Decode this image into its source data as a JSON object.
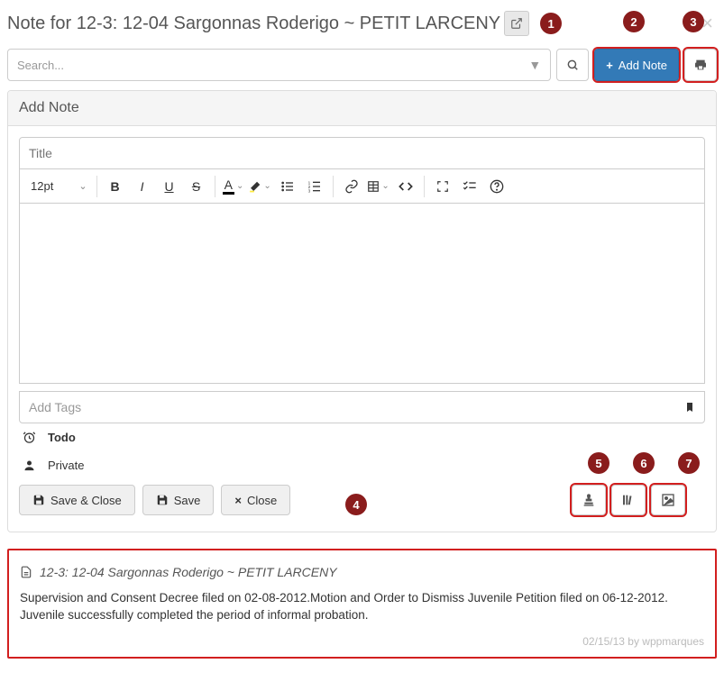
{
  "header": {
    "title": "Note for 12-3: 12-04 Sargonnas Roderigo ~ PETIT LARCENY"
  },
  "search": {
    "placeholder": "Search..."
  },
  "addNote": {
    "label": "Add Note"
  },
  "panel": {
    "title": "Add Note"
  },
  "editor": {
    "titlePlaceholder": "Title",
    "fontSize": "12pt",
    "tagsPlaceholder": "Add Tags"
  },
  "toggles": {
    "todo": "Todo",
    "private": "Private"
  },
  "buttons": {
    "saveClose": "Save & Close",
    "save": "Save",
    "close": "Close"
  },
  "callouts": {
    "c1": "1",
    "c2": "2",
    "c3": "3",
    "c4": "4",
    "c5": "5",
    "c6": "6",
    "c7": "7"
  },
  "existingNote": {
    "title": "12-3: 12-04 Sargonnas Roderigo ~ PETIT LARCENY",
    "body": "Supervision and Consent Decree filed on 02-08-2012.Motion and Order to Dismiss Juvenile Petition filed on 06-12-2012. Juvenile successfully completed the period of informal probation.",
    "meta": "02/15/13 by wppmarques"
  }
}
